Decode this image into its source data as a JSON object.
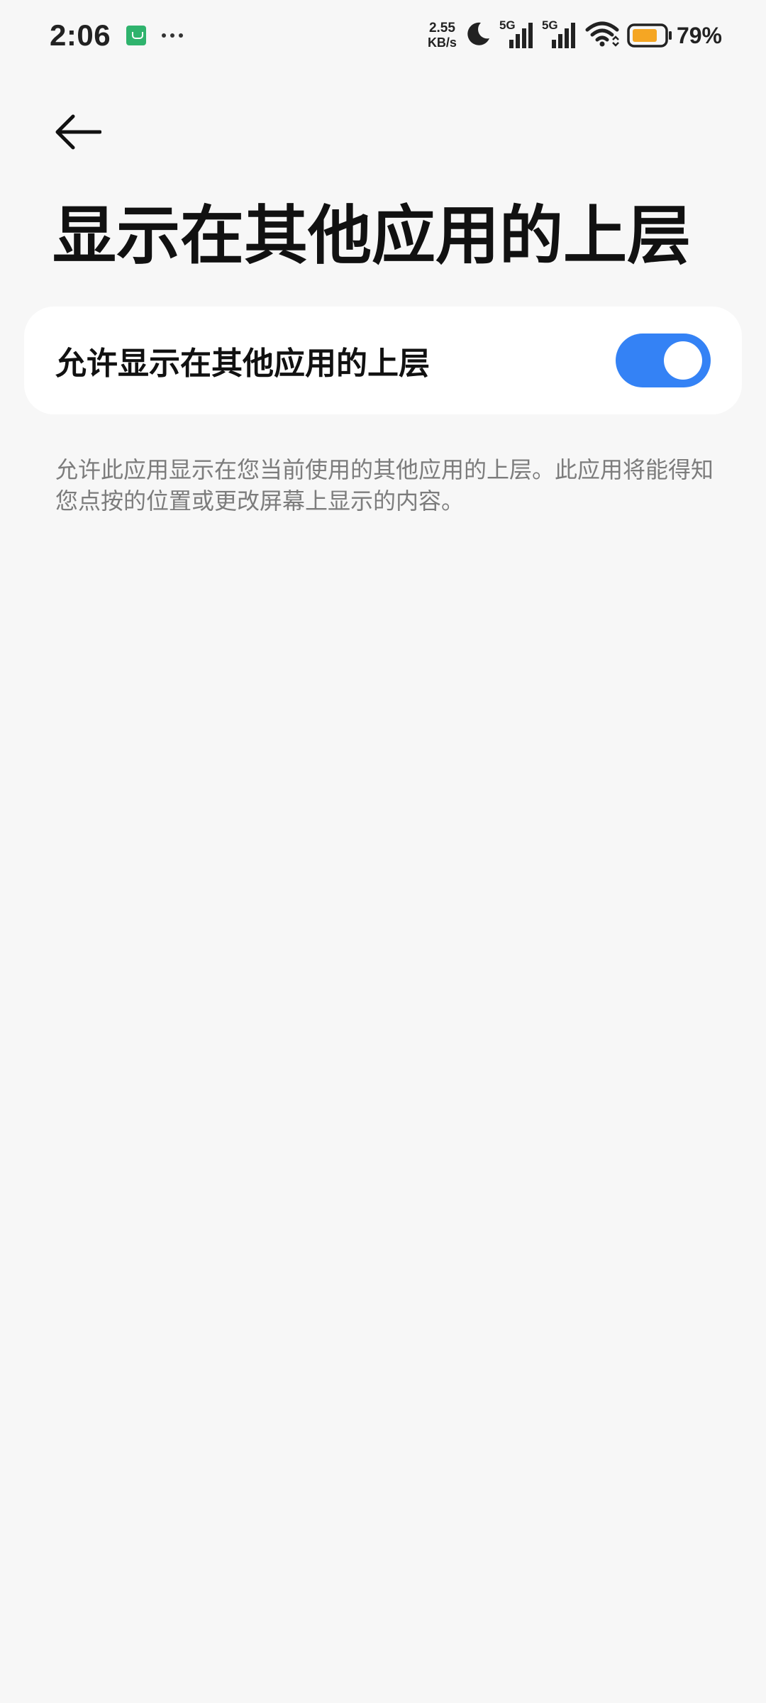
{
  "status_bar": {
    "time": "2:06",
    "net_speed_value": "2.55",
    "net_speed_unit": "KB/s",
    "signal_1_label": "5G",
    "signal_2_label": "5G",
    "battery_percent": "79%",
    "battery_color": "#f5a623",
    "notification_app_color": "#2fb36d"
  },
  "header": {
    "back_icon": "arrow-left-icon",
    "title": "显示在其他应用的上层"
  },
  "setting": {
    "label": "允许显示在其他应用的上层",
    "toggle_state": "on",
    "toggle_color": "#3482f5"
  },
  "description": "允许此应用显示在您当前使用的其他应用的上层。此应用将能得知您点按的位置或更改屏幕上显示的内容。"
}
